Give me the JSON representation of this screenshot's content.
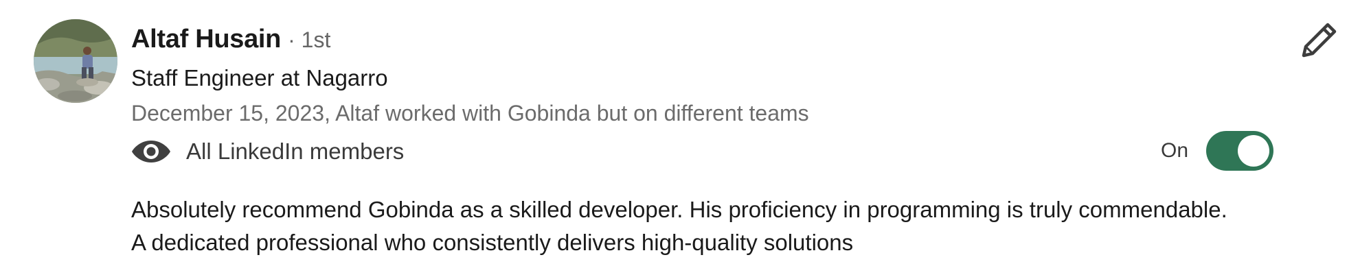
{
  "recommendation": {
    "author_name": "Altaf Husain",
    "connection_degree": "· 1st",
    "headline": "Staff Engineer at Nagarro",
    "meta": "December 15, 2023, Altaf worked with Gobinda but on different teams",
    "visibility": {
      "icon": "eye-icon",
      "label": "All LinkedIn members"
    },
    "toggle": {
      "label": "On",
      "state": "on",
      "accent_color": "#2f7656"
    },
    "edit_icon": "pencil-icon",
    "text": "Absolutely recommend Gobinda as a skilled developer. His proficiency in programming is truly commendable. A dedicated professional who consistently delivers high-quality solutions"
  }
}
